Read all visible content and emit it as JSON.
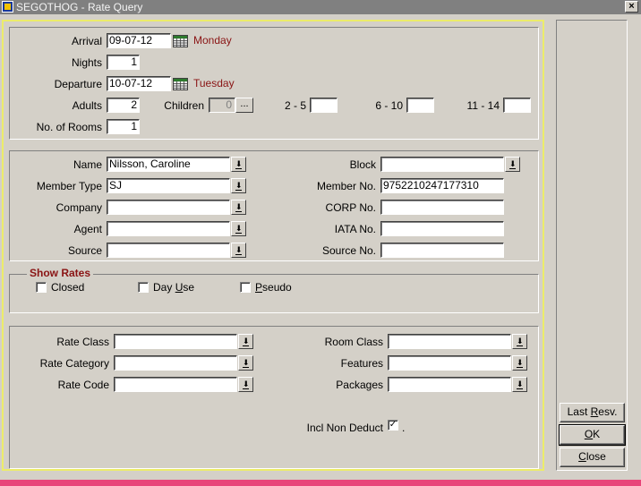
{
  "window": {
    "title": "SEGOTHOG - Rate Query",
    "close_glyph": "×"
  },
  "stay": {
    "arrival_label": "Arrival",
    "arrival_value": "09-07-12",
    "arrival_day": "Monday",
    "nights_label": "Nights",
    "nights_value": "1",
    "departure_label": "Departure",
    "departure_value": "10-07-12",
    "departure_day": "Tuesday",
    "adults_label": "Adults",
    "adults_value": "2",
    "children_label": "Children",
    "children_value": "0",
    "children_button": "...",
    "age_2_5_label": "2 - 5",
    "age_2_5_value": "",
    "age_6_10_label": "6 - 10",
    "age_6_10_value": "",
    "age_11_14_label": "11 - 14",
    "age_11_14_value": "",
    "rooms_label": "No. of Rooms",
    "rooms_value": "1"
  },
  "profile": {
    "name_label": "Name",
    "name_value": "Nilsson, Caroline",
    "member_type_label": "Member Type",
    "member_type_value": "SJ",
    "company_label": "Company",
    "company_value": "",
    "agent_label": "Agent",
    "agent_value": "",
    "source_label": "Source",
    "source_value": "",
    "block_label": "Block",
    "block_value": "",
    "member_no_label": "Member No.",
    "member_no_value": "9752210247177310",
    "corp_no_label": "CORP No.",
    "corp_no_value": "",
    "iata_no_label": "IATA No.",
    "iata_no_value": "",
    "source_no_label": "Source No.",
    "source_no_value": ""
  },
  "show_rates": {
    "title": "Show Rates",
    "closed_label": "Closed",
    "closed_checked": false,
    "dayuse_pre": "Day ",
    "dayuse_ul": "U",
    "dayuse_post": "se",
    "dayuse_checked": false,
    "pseudo_ul": "P",
    "pseudo_post": "seudo",
    "pseudo_checked": false
  },
  "filters": {
    "rate_class_label": "Rate Class",
    "rate_class_value": "",
    "rate_category_label": "Rate Category",
    "rate_category_value": "",
    "rate_code_label": "Rate Code",
    "rate_code_value": "",
    "room_class_label": "Room Class",
    "room_class_value": "",
    "features_label": "Features",
    "features_value": "",
    "packages_label": "Packages",
    "packages_value": "",
    "incl_non_deduct_label": "Incl Non Deduct",
    "incl_non_deduct_checked": true,
    "incl_non_deduct_glyph": "✓",
    "incl_non_deduct_suffix": "."
  },
  "buttons": {
    "last_resv_pre": "Last ",
    "last_resv_ul": "R",
    "last_resv_post": "esv.",
    "ok_ul": "O",
    "ok_post": "K",
    "close_ul": "C",
    "close_post": "lose"
  },
  "icons": {
    "dropdown_glyph": "⬇"
  },
  "colors": {
    "day_text": "#8a1414",
    "panel_border": "#ecec6a",
    "desktop": "#e8457a"
  }
}
